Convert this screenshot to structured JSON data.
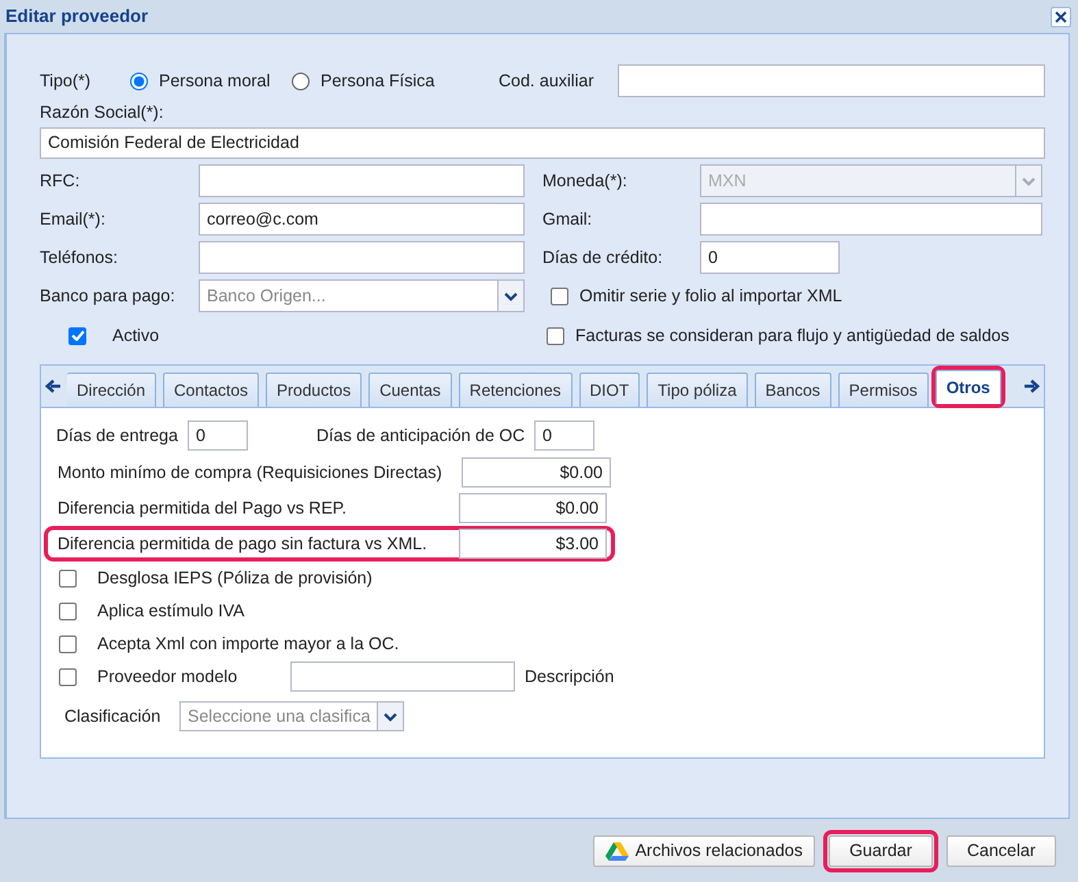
{
  "window": {
    "title": "Editar proveedor"
  },
  "tipo": {
    "label": "Tipo(*)",
    "options": [
      {
        "label": "Persona moral",
        "selected": true
      },
      {
        "label": "Persona Física",
        "selected": false
      }
    ]
  },
  "cod_auxiliar": {
    "label": "Cod. auxiliar"
  },
  "razon_social": {
    "label": "Razón Social(*):",
    "value": "Comisión Federal de Electricidad"
  },
  "rfc": {
    "label": "RFC:"
  },
  "moneda": {
    "label": "Moneda(*):",
    "value": "MXN",
    "disabled": true
  },
  "email": {
    "label": "Email(*):",
    "value": "correo@c.com"
  },
  "gmail": {
    "label": "Gmail:"
  },
  "telefonos": {
    "label": "Teléfonos:"
  },
  "dias_credito": {
    "label": "Días de crédito:",
    "value": "0"
  },
  "banco": {
    "label": "Banco para pago:",
    "placeholder": "Banco Origen..."
  },
  "omitir_serie": {
    "label": "Omitir serie y folio al importar XML",
    "checked": false
  },
  "activo": {
    "label": "Activo",
    "checked": true
  },
  "facturas_flujo": {
    "label": "Facturas se consideran para flujo y antigüedad de saldos",
    "checked": false
  },
  "tabs": [
    {
      "label": "Dirección",
      "selected": false,
      "highlighted": false
    },
    {
      "label": "Contactos",
      "selected": false,
      "highlighted": false
    },
    {
      "label": "Productos",
      "selected": false,
      "highlighted": false
    },
    {
      "label": "Cuentas",
      "selected": false,
      "highlighted": false
    },
    {
      "label": "Retenciones",
      "selected": false,
      "highlighted": false
    },
    {
      "label": "DIOT",
      "selected": false,
      "highlighted": false
    },
    {
      "label": "Tipo póliza",
      "selected": false,
      "highlighted": false
    },
    {
      "label": "Bancos",
      "selected": false,
      "highlighted": false
    },
    {
      "label": "Permisos",
      "selected": false,
      "highlighted": false
    },
    {
      "label": "Otros",
      "selected": true,
      "highlighted": true
    }
  ],
  "otros": {
    "dias_entrega": {
      "label": "Días de entrega",
      "value": "0"
    },
    "dias_anticipacion": {
      "label": "Días de anticipación de OC",
      "value": "0"
    },
    "amounts": [
      {
        "label": "Monto minímo de compra (Requisiciones Directas)",
        "value": "$0.00",
        "highlighted": false
      },
      {
        "label": "Diferencia permitida del Pago vs REP.",
        "value": "$0.00",
        "highlighted": false
      },
      {
        "label": "Diferencia permitida de pago sin factura vs XML.",
        "value": "$3.00",
        "highlighted": true
      }
    ],
    "checks": [
      {
        "label": "Desglosa IEPS (Póliza de provisión)",
        "checked": false
      },
      {
        "label": "Aplica estímulo IVA",
        "checked": false
      },
      {
        "label": "Acepta Xml con importe mayor a la OC.",
        "checked": false
      }
    ],
    "proveedor_modelo": {
      "label": "Proveedor modelo",
      "checked": false,
      "description_label": "Descripción"
    },
    "clasificacion": {
      "label": "Clasificación",
      "placeholder": "Seleccione una clasifica"
    }
  },
  "buttons": [
    {
      "label": "Archivos relacionados",
      "kind": "drive",
      "highlighted": false
    },
    {
      "label": "Guardar",
      "kind": "plain",
      "highlighted": true
    },
    {
      "label": "Cancelar",
      "kind": "plain",
      "highlighted": false
    }
  ]
}
